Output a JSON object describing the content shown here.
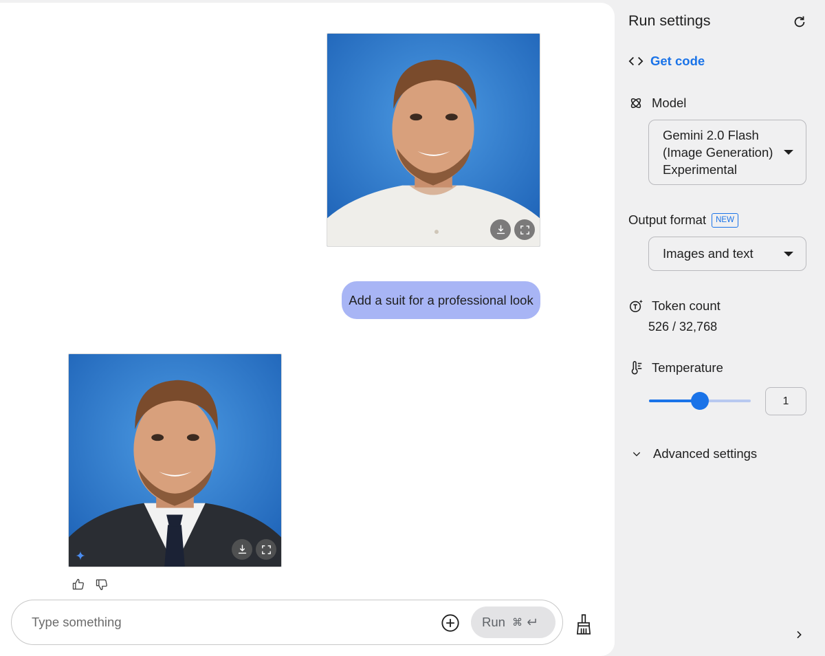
{
  "chat": {
    "user_message": "Add a suit for a professional look",
    "input_placeholder": "Type something",
    "run_label": "Run",
    "run_shortcut": "⌘",
    "icons": [
      "download-icon",
      "fullscreen-icon",
      "sparkle-icon",
      "thumb-up-icon",
      "thumb-down-icon",
      "add-circle-icon",
      "enter-icon",
      "broom-icon"
    ]
  },
  "settings": {
    "title": "Run settings",
    "get_code": "Get code",
    "model_label": "Model",
    "model_value": "Gemini 2.0 Flash (Image Generation) Experimental",
    "output_format_label": "Output format",
    "output_format_badge": "NEW",
    "output_format_value": "Images and text",
    "token_count_label": "Token count",
    "token_count_value": "526 / 32,768",
    "temperature_label": "Temperature",
    "temperature_value": "1",
    "temperature_fraction": 0.5,
    "advanced_label": "Advanced settings",
    "icons": [
      "refresh-icon",
      "code-icon",
      "model-icon",
      "token-icon",
      "thermometer-icon",
      "chevron-down-icon",
      "chevron-right-icon"
    ]
  },
  "colors": {
    "accent": "#1a73e8",
    "user_bubble": "#a8b5f5",
    "photo_background": "#2f7fd0"
  }
}
